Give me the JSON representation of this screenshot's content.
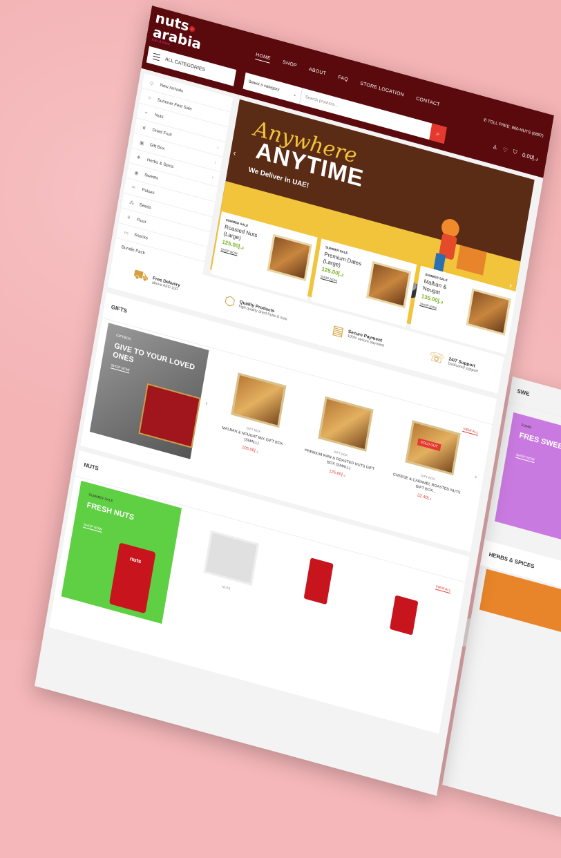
{
  "brand": {
    "name_line1": "nuts",
    "name_line2": "arabia",
    "tagline": "nuts & more"
  },
  "nav": {
    "items": [
      "HOME",
      "SHOP",
      "ABOUT",
      "FAQ",
      "STORE LOCATION",
      "CONTACT"
    ]
  },
  "header": {
    "all_categories": "ALL CATEGORIES",
    "select_category": "Select a category",
    "search_placeholder": "Search products...",
    "toll_free": "TOLL FREE: 800-NUTS (6887)",
    "cart_total": "د.إ0.00",
    "cart_count": "0",
    "wishlist_count": "0"
  },
  "sidebar": {
    "items": [
      {
        "label": "New Arrivals",
        "icon": "tag-icon",
        "chevron": false
      },
      {
        "label": "Summer Fest Sale",
        "icon": "sun-icon",
        "chevron": false
      },
      {
        "label": "Nuts",
        "icon": "nut-icon",
        "chevron": false
      },
      {
        "label": "Dried Fruit",
        "icon": "fruit-icon",
        "chevron": true
      },
      {
        "label": "Gift Box",
        "icon": "gift-icon",
        "chevron": true
      },
      {
        "label": "Herbs & Spics",
        "icon": "herb-icon",
        "chevron": true
      },
      {
        "label": "Sweets",
        "icon": "sweet-icon",
        "chevron": false
      },
      {
        "label": "Pulses",
        "icon": "pulse-icon",
        "chevron": false
      },
      {
        "label": "Seeds",
        "icon": "seed-icon",
        "chevron": false
      },
      {
        "label": "Flour",
        "icon": "flour-icon",
        "chevron": false
      },
      {
        "label": "Snacks",
        "icon": "snack-icon",
        "chevron": false
      },
      {
        "label": "Bundle Pack",
        "icon": "",
        "chevron": false
      }
    ]
  },
  "hero": {
    "script": "Anywhere",
    "headline": "ANYTIME",
    "subline": "We Deliver in UAE!"
  },
  "promos": [
    {
      "tag": "SUMMER SALE",
      "name": "Roasted Nuts (Large)",
      "price": "125.00د.إ",
      "cta": "SHOP NOW"
    },
    {
      "tag": "SUMMER SALE",
      "name": "Premium Dates (Large)",
      "price": "125.00د.إ",
      "cta": "SHOP NOW"
    },
    {
      "tag": "SUMMER SALE",
      "name": "Malban & Nougat",
      "price": "135.00د.إ",
      "cta": "SHOP NOW"
    }
  ],
  "features": [
    {
      "title": "Free Delivery",
      "sub": "above AED 100",
      "icon": "truck-icon"
    },
    {
      "title": "Quality Products",
      "sub": "high quality dried fruits & nuts",
      "icon": "box-icon"
    },
    {
      "title": "Secure Payment",
      "sub": "100% secure payment",
      "icon": "card-icon"
    },
    {
      "title": "24/7 Support",
      "sub": "Dedicated support",
      "icon": "headset-icon"
    }
  ],
  "gifts": {
    "title": "GIFTS",
    "banner": {
      "tag": "GIFTBOX",
      "heading": "GIVE TO YOUR LOVED ONES",
      "cta": "SHOP NOW"
    },
    "view_all": "VIEW ALL",
    "products": [
      {
        "cat": "GIFT BOX",
        "name": "MALBAN & NOUGAT MIX GIFT BOX (SMALL)",
        "price": "د.إ105.00",
        "sold_out": false
      },
      {
        "cat": "GIFT BOX",
        "name": "PREMIUM RAW & ROASTED NUTS GIFT BOX (SMALL)",
        "price": "د.إ125.00",
        "sold_out": false
      },
      {
        "cat": "GIFT BOX",
        "name": "CHEESE & CARAMEL ROASTED NUTS GIFT BOX...",
        "price": "د.إ32.40",
        "sold_out": true,
        "sold_label": "SOLD OUT"
      }
    ]
  },
  "nuts": {
    "title": "NUTS",
    "banner": {
      "tag": "SUMMER SALE",
      "heading": "FRESH NUTS",
      "cta": "SHOP NOW"
    },
    "view_all": "VIEW ALL",
    "first_cat": "NUTS"
  },
  "side": {
    "sweets_title": "SWE",
    "sweets_banner": {
      "tag": "SUMM",
      "heading": "FRES SWEE",
      "cta": "SHOP NOW"
    },
    "herbs_title": "HERBS & SPICES"
  }
}
